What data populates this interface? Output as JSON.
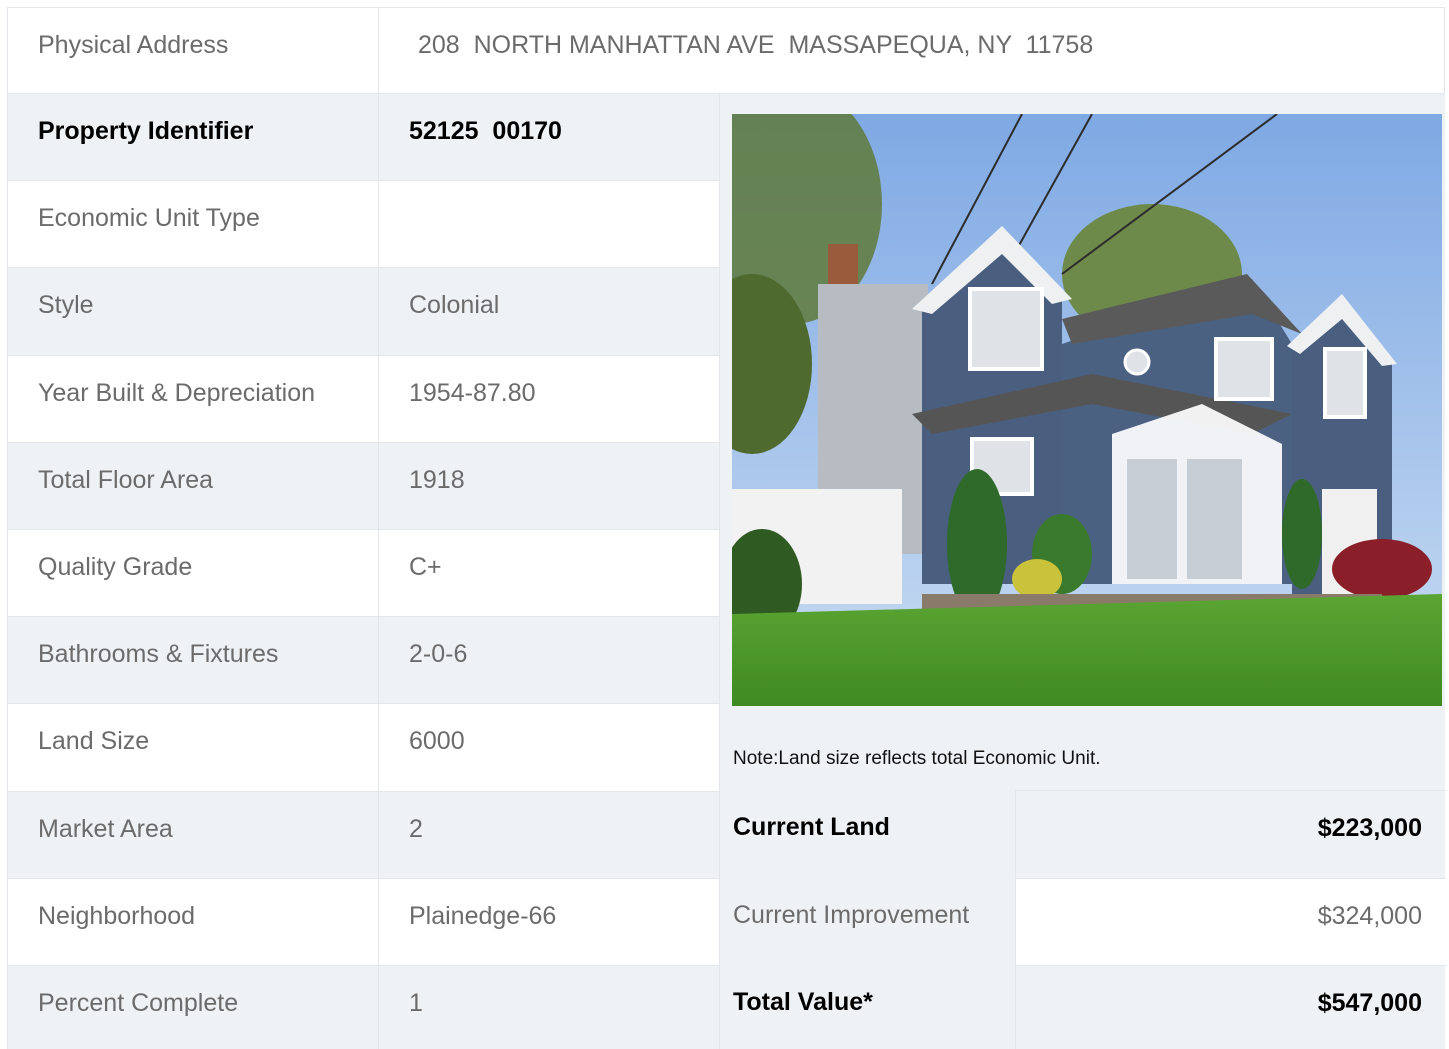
{
  "address": {
    "label": "Physical Address",
    "value": "208  NORTH MANHATTAN AVE  MASSAPEQUA, NY  11758"
  },
  "details": [
    {
      "label": "Property Identifier",
      "value": "52125  00170",
      "bold": true
    },
    {
      "label": "Economic Unit Type",
      "value": ""
    },
    {
      "label": "Style",
      "value": "Colonial"
    },
    {
      "label": "Year Built & Depreciation",
      "value": "1954-87.80"
    },
    {
      "label": "Total Floor Area",
      "value": "1918"
    },
    {
      "label": "Quality Grade",
      "value": "C+"
    },
    {
      "label": "Bathrooms & Fixtures",
      "value": "2-0-6"
    },
    {
      "label": "Land Size",
      "value": "6000"
    },
    {
      "label": "Market Area",
      "value": "2"
    },
    {
      "label": "Neighborhood",
      "value": "Plainedge-66"
    },
    {
      "label": "Percent Complete",
      "value": "1"
    }
  ],
  "note": "Note:Land size reflects total Economic Unit.",
  "values": {
    "land": {
      "label": "Current Land",
      "value": "$223,000"
    },
    "improvement": {
      "label": "Current Improvement",
      "value": "$324,000"
    },
    "total": {
      "label": "Total Value*",
      "value": "$547,000"
    }
  },
  "colors": {
    "shade": "#eff2f5",
    "border": "#e3e6ea",
    "house_siding": "#4a5f7f",
    "lawn": "#4f9a2c",
    "sky": "#a9c8ee"
  }
}
